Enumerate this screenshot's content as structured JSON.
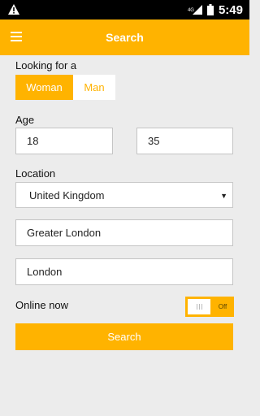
{
  "status_bar": {
    "network_label": "4G",
    "time": "5:49",
    "icons": [
      "warning-icon",
      "signal-icon",
      "battery-icon"
    ]
  },
  "app_bar": {
    "title": "Search",
    "menu_icon": "hamburger-menu-icon"
  },
  "looking_for": {
    "label": "Looking for a",
    "options": [
      "Woman",
      "Man"
    ],
    "selected": "Woman"
  },
  "age": {
    "label": "Age",
    "min_value": "18",
    "max_value": "35"
  },
  "location": {
    "label": "Location",
    "country": "United Kingdom",
    "region": "Greater London",
    "city": "London"
  },
  "online_now": {
    "label": "Online now",
    "toggle_state_label": "Off"
  },
  "search_button": {
    "label": "Search"
  },
  "colors": {
    "accent": "#ffb300",
    "background": "#ececec",
    "status_bar": "#000000"
  }
}
